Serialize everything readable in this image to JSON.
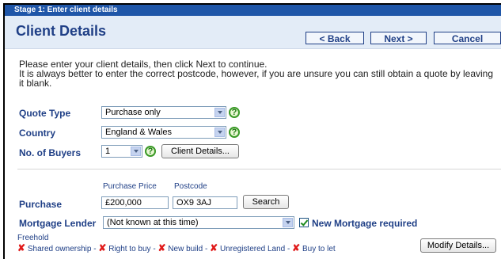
{
  "stage": "Stage 1: Enter client details",
  "header": {
    "title": "Client Details",
    "back": "< Back",
    "next": "Next >",
    "cancel": "Cancel"
  },
  "intro": {
    "line1": "Please enter your client details, then click Next to continue.",
    "line2": "It is always better to enter the correct postcode, however, if you are unsure you can still obtain a quote by leaving it blank."
  },
  "fields": {
    "quote_type": {
      "label": "Quote Type",
      "value": "Purchase only"
    },
    "country": {
      "label": "Country",
      "value": "England & Wales"
    },
    "buyers": {
      "label": "No. of Buyers",
      "value": "1",
      "button": "Client Details..."
    }
  },
  "purchase": {
    "price_label": "Purchase Price",
    "postcode_label": "Postcode",
    "label": "Purchase",
    "price": "£200,000",
    "postcode": "OX9 3AJ",
    "search": "Search"
  },
  "lender": {
    "label": "Mortgage Lender",
    "value": "(Not known at this time)",
    "new_mortgage": "New Mortgage required"
  },
  "summary": {
    "freehold": "Freehold",
    "items": [
      "Shared ownership",
      "Right to buy",
      "New build",
      "Unregistered Land",
      "Buy to let"
    ],
    "modify": "Modify Details..."
  },
  "icons": {
    "help": "?",
    "cross": "✘"
  }
}
